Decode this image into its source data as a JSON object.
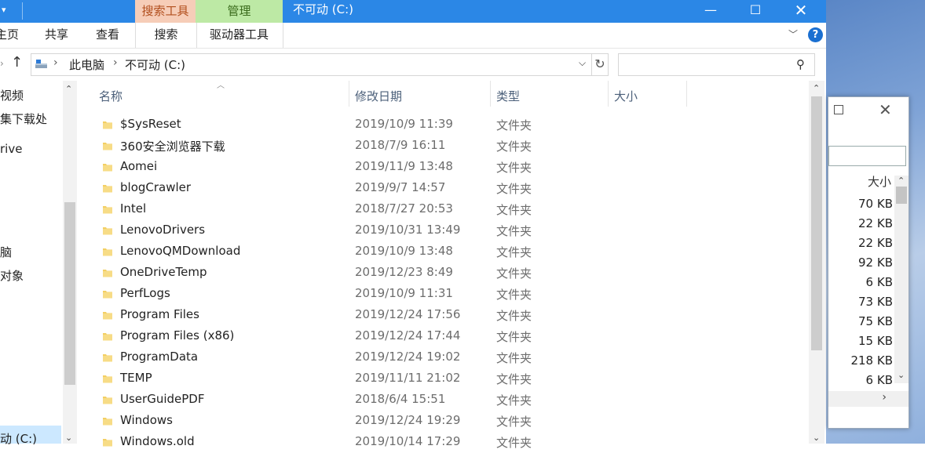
{
  "window": {
    "title": "不可动 (C:)",
    "title_arrow": "▾",
    "min_glyph": "—",
    "max_glyph": "☐",
    "close_glyph": "✕",
    "contextual_tabs": {
      "search_tools": "搜索工具",
      "manage": "管理"
    }
  },
  "ribbon": {
    "tabs": [
      "主页",
      "共享",
      "查看",
      "搜索",
      "驱动器工具"
    ],
    "help_glyph": "?",
    "expand_glyph": "﹀"
  },
  "address": {
    "crumbs": [
      "此电脑",
      "不可动 (C:)"
    ],
    "chevron": "›",
    "dropdown_glyph": "⌵",
    "refresh_glyph": "↻",
    "up_glyph": "↑",
    "search_placeholder": "",
    "search_glyph": "⚲"
  },
  "nav_pane": {
    "items": [
      "视频",
      "集下载处",
      "rive",
      "脑",
      "对象",
      "动 (C:)"
    ],
    "scroll_up": "⌃",
    "scroll_down": "⌄"
  },
  "columns": {
    "name": "名称",
    "date": "修改日期",
    "type": "类型",
    "size": "大小"
  },
  "files": [
    {
      "name": "$SysReset",
      "date": "2019/10/9 11:39",
      "type": "文件夹"
    },
    {
      "name": "360安全浏览器下载",
      "date": "2018/7/9 16:11",
      "type": "文件夹"
    },
    {
      "name": "Aomei",
      "date": "2019/11/9 13:48",
      "type": "文件夹"
    },
    {
      "name": "blogCrawler",
      "date": "2019/9/7 14:57",
      "type": "文件夹"
    },
    {
      "name": "Intel",
      "date": "2018/7/27 20:53",
      "type": "文件夹"
    },
    {
      "name": "LenovoDrivers",
      "date": "2019/10/31 13:49",
      "type": "文件夹"
    },
    {
      "name": "LenovoQMDownload",
      "date": "2019/10/9 13:48",
      "type": "文件夹"
    },
    {
      "name": "OneDriveTemp",
      "date": "2019/12/23 8:49",
      "type": "文件夹"
    },
    {
      "name": "PerfLogs",
      "date": "2019/10/9 11:31",
      "type": "文件夹"
    },
    {
      "name": "Program Files",
      "date": "2019/12/24 17:56",
      "type": "文件夹"
    },
    {
      "name": "Program Files (x86)",
      "date": "2019/12/24 17:44",
      "type": "文件夹"
    },
    {
      "name": "ProgramData",
      "date": "2019/12/24 19:02",
      "type": "文件夹"
    },
    {
      "name": "TEMP",
      "date": "2019/11/11 21:02",
      "type": "文件夹"
    },
    {
      "name": "UserGuidePDF",
      "date": "2018/6/4 15:51",
      "type": "文件夹"
    },
    {
      "name": "Windows",
      "date": "2019/12/24 19:29",
      "type": "文件夹"
    },
    {
      "name": "Windows.old",
      "date": "2019/10/14 17:29",
      "type": "文件夹"
    }
  ],
  "background_window": {
    "size_header": "大小",
    "sizes": [
      "70 KB",
      "22 KB",
      "22 KB",
      "92 KB",
      "6 KB",
      "73 KB",
      "75 KB",
      "15 KB",
      "218 KB",
      "6 KB"
    ],
    "close_glyph": "✕",
    "hscroll_glyph": "›"
  },
  "colors": {
    "titlebar": "#2b87e6",
    "search_tools_tab": "#f6cdb8",
    "manage_tab": "#bde9a5",
    "folder": "#f3cf63",
    "selection": "#cce8ff"
  }
}
